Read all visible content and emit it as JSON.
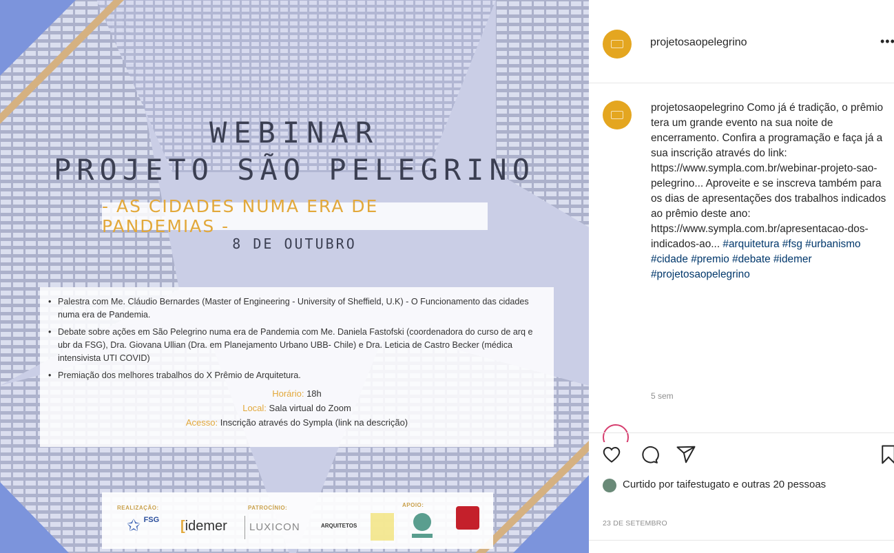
{
  "post": {
    "title_line1": "WEBINAR",
    "title_line2": "PROJETO SÃO PELEGRINO",
    "subtitle": "- AS CIDADES NUMA ERA DE PANDEMIAS -",
    "date": "8 DE OUTUBRO",
    "bullets": [
      "Palestra com Me. Cláudio Bernardes (Master of Engineering - University of Sheffield, U.K) - O Funcionamento das cidades numa era de Pandemia.",
      "Debate sobre ações em São Pelegrino numa era de Pandemia com Me. Daniela Fastofski (coordenadora do curso de arq e ubr da FSG), Dra. Giovana Ullian (Dra. em Planejamento Urbano UBB- Chile) e Dra. Leticia de Castro Becker (médica intensivista UTI COVID)",
      "Premiação dos melhores trabalhos do X Prêmio de Arquitetura."
    ],
    "details": [
      {
        "label": "Horário:",
        "value": "18h"
      },
      {
        "label": "Local:",
        "value": "Sala virtual do Zoom"
      },
      {
        "label": "Acesso:",
        "value": "Inscrição através do Sympla (link na descrição)"
      }
    ],
    "sponsors": {
      "realizacao_label": "REALIZAÇÃO:",
      "patrocinio_label": "PATROCÍNIO:",
      "apoio_label": "APOIO:",
      "logo_fsg": "FSG",
      "logo_idemer": "idemer",
      "logo_luxicon": "LUXICON",
      "logo_arquitetos": "ARQUITETOS"
    }
  },
  "side": {
    "username": "projetosaopelegrino",
    "more": "•••",
    "caption_user": "projetosaopelegrino",
    "caption_text": " Como já é tradição, o prêmio tera um grande evento na sua noite de encerramento. Confira a programação e faça já a sua inscrição através do link: https://www.sympla.com.br/webinar-projeto-sao-pelegrino... Aproveite e se inscreva também para os dias de apresentações dos trabalhos indicados ao prêmio deste ano: https://www.sympla.com.br/apresentacao-dos-indicados-ao...",
    "hashtags": "#arquitetura #fsg #urbanismo #cidade #premio #debate #idemer #projetosaopelegrino",
    "caption_time": "5 sem",
    "liked_by": "Curtido por taifestugato e outras 20 pessoas",
    "post_date": "23 DE SETEMBRO"
  },
  "colors": {
    "accent": "#e2a83a",
    "avatar": "#e4a620",
    "hashtag": "#00376b",
    "title": "#3b3f52"
  },
  "icons": [
    "heart-icon",
    "comment-icon",
    "share-icon",
    "bookmark-icon",
    "more-icon"
  ]
}
